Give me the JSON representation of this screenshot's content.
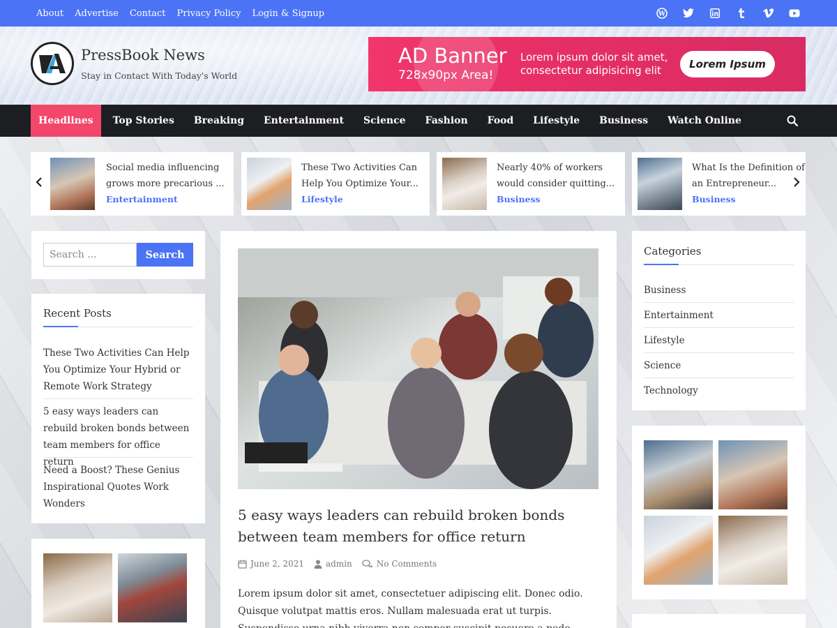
{
  "topbar": {
    "links": [
      "About",
      "Advertise",
      "Contact",
      "Privacy Policy",
      "Login & Signup"
    ],
    "social_icons": [
      "wordpress-icon",
      "twitter-icon",
      "linkedin-icon",
      "tumblr-icon",
      "vimeo-icon",
      "youtube-icon"
    ],
    "color": "#4b73f5"
  },
  "header": {
    "site_title": "PressBook News",
    "tagline": "Stay in Contact With Today's World"
  },
  "ad": {
    "title": "AD Banner",
    "size": "728x90px Area!",
    "text": "Lorem ipsum dolor sit amet, consectetur adipisicing elit",
    "button": "Lorem Ipsum",
    "color": "#f2366b"
  },
  "nav": {
    "items": [
      "Headlines",
      "Top Stories",
      "Breaking",
      "Entertainment",
      "Science",
      "Fashion",
      "Food",
      "Lifestyle",
      "Business",
      "Watch Online"
    ],
    "active": "Headlines",
    "accent": "#f2466a"
  },
  "ticker": [
    {
      "title": "Social media influencing grows more precarious ...",
      "category": "Entertainment"
    },
    {
      "title": "These Two Activities Can Help You Optimize Your...",
      "category": "Lifestyle"
    },
    {
      "title": "Nearly 40% of workers would consider quitting...",
      "category": "Business"
    },
    {
      "title": "What Is the Definition of an Entrepreneur...",
      "category": "Business"
    }
  ],
  "search": {
    "placeholder": "Search ...",
    "button": "Search"
  },
  "recent_posts": {
    "title": "Recent Posts",
    "items": [
      "These Two Activities Can Help You Optimize Your Hybrid or Remote Work Strategy",
      "5 easy ways leaders can rebuild broken bonds between team members for office return",
      "Need a Boost? These Genius Inspirational Quotes Work Wonders"
    ]
  },
  "main_post": {
    "title": "5 easy ways leaders can rebuild broken bonds between team members for office return",
    "date": "June 2, 2021",
    "author": "admin",
    "comments": "No Comments",
    "excerpt": "Lorem ipsum dolor sit amet, consectetuer adipiscing elit. Donec odio. Quisque volutpat mattis eros. Nullam malesuada erat ut turpis. Suspendisse urna nibh viverra non semper suscipit posuere a pede."
  },
  "categories": {
    "title": "Categories",
    "items": [
      "Business",
      "Entertainment",
      "Lifestyle",
      "Science",
      "Technology"
    ]
  }
}
